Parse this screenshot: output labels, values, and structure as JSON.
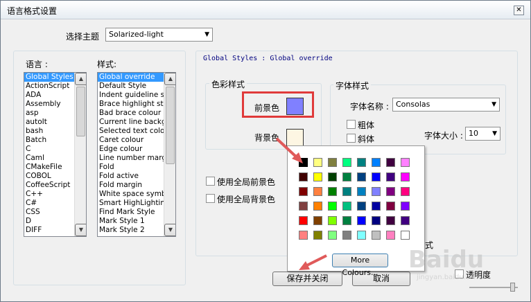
{
  "window": {
    "title": "语言格式设置"
  },
  "theme": {
    "label": "选择主题",
    "value": "Solarized-light"
  },
  "languages": {
    "label": "语言 :",
    "items": [
      "Global Styles",
      "ActionScript",
      "ADA",
      "Assembly",
      "asp",
      "autoIt",
      "bash",
      "Batch",
      "C",
      "Caml",
      "CMakeFile",
      "COBOL",
      "CoffeeScript",
      "C++",
      "C#",
      "CSS",
      "D",
      "DIFF"
    ]
  },
  "styles": {
    "label": "样式:",
    "items": [
      "Global override",
      "Default Style",
      "Indent guideline sty",
      "Brace highlight style",
      "Bad brace colour",
      "Current line backgr",
      "Selected text colou",
      "Caret colour",
      "Edge colour",
      "Line number margin",
      "Fold",
      "Fold active",
      "Fold margin",
      "White space symbo",
      "Smart HighLighting",
      "Find Mark Style",
      "Mark Style 1",
      "Mark Style 2"
    ]
  },
  "header_text": "Global Styles : Global override",
  "color_group": {
    "legend": "色彩样式",
    "fg_label": "前景色",
    "bg_label": "背景色",
    "fg_color": "#8080ff",
    "bg_color": "#fdf6e3"
  },
  "font_group": {
    "legend": "字体样式",
    "name_label": "字体名称 :",
    "font_value": "Consolas",
    "bold": "粗体",
    "italic": "斜体",
    "size_label": "字体大小 :",
    "size_value": "10"
  },
  "global_fg": "使用全局前景色",
  "global_bg": "使用全局背景色",
  "hidden_text": "式",
  "transparency": "透明度",
  "save_button": "保存并关闭",
  "cancel_button": "取消",
  "more_colours": "More Colours...",
  "palette": [
    [
      "#000000",
      "#ffff80",
      "#808040",
      "#00ff80",
      "#008080",
      "#0080ff",
      "#400040",
      "#ff80ff"
    ],
    [
      "#400000",
      "#ffff00",
      "#004000",
      "#008040",
      "#004080",
      "#0000ff",
      "#400080",
      "#ff00ff"
    ],
    [
      "#800000",
      "#ff8040",
      "#008000",
      "#008080",
      "#0080c0",
      "#8080ff",
      "#800080",
      "#ff0080"
    ],
    [
      "#804040",
      "#ff8000",
      "#00ff00",
      "#00c080",
      "#004080",
      "#0000a0",
      "#800040",
      "#8000ff"
    ],
    [
      "#ff0000",
      "#804000",
      "#80ff00",
      "#008040",
      "#0000ff",
      "#000080",
      "#400040",
      "#400080"
    ],
    [
      "#ff8080",
      "#808000",
      "#80ff80",
      "#808080",
      "#80ffff",
      "#c0c0c0",
      "#ff80c0",
      "#ffffff"
    ]
  ],
  "watermark": {
    "brand": "Baidu",
    "sub": "jingyan.baidu.com"
  }
}
